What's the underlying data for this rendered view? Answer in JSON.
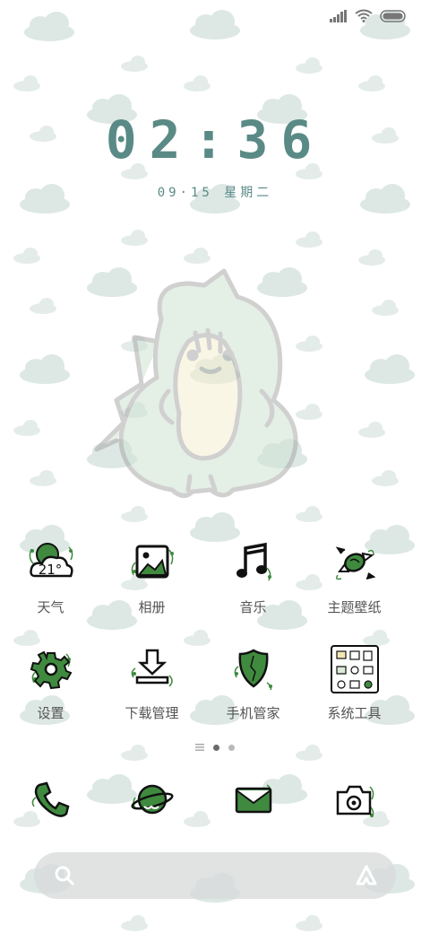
{
  "status_bar": {
    "signal_icon": "signal-icon",
    "wifi_icon": "wifi-icon",
    "battery_icon": "battery-icon"
  },
  "lock": {
    "time": "02:36",
    "date": "09·15 星期二"
  },
  "apps": [
    {
      "label": "天气",
      "icon": "weather-icon",
      "temp": "21°"
    },
    {
      "label": "相册",
      "icon": "gallery-icon"
    },
    {
      "label": "音乐",
      "icon": "music-icon"
    },
    {
      "label": "主题壁纸",
      "icon": "theme-icon"
    },
    {
      "label": "设置",
      "icon": "settings-icon"
    },
    {
      "label": "下载管理",
      "icon": "download-icon"
    },
    {
      "label": "手机管家",
      "icon": "security-icon"
    },
    {
      "label": "系统工具",
      "icon": "tools-icon"
    }
  ],
  "dock": [
    {
      "icon": "phone-icon"
    },
    {
      "icon": "browser-icon"
    },
    {
      "icon": "messages-icon"
    },
    {
      "icon": "camera-icon"
    }
  ],
  "page_indicator": {
    "pages": 2,
    "current": 1
  },
  "colors": {
    "accent": "#5a8a86",
    "leaf_green": "#3f8a3f",
    "cloud": "#dde8e5"
  }
}
